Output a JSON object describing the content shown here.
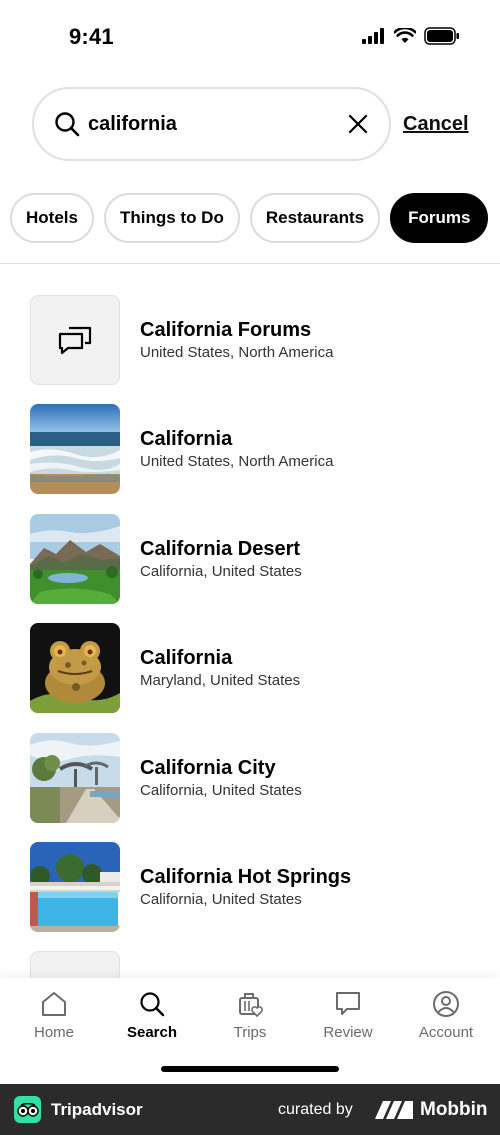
{
  "status_bar": {
    "time": "9:41"
  },
  "search": {
    "value": "california",
    "placeholder": "",
    "cancel_label": "Cancel"
  },
  "chips": [
    {
      "label": "Hotels",
      "active": false
    },
    {
      "label": "Things to Do",
      "active": false
    },
    {
      "label": "Restaurants",
      "active": false
    },
    {
      "label": "Forums",
      "active": true
    }
  ],
  "results": [
    {
      "title": "California Forums",
      "subtitle": "United States, North America",
      "thumb": "forum-icon"
    },
    {
      "title": "California",
      "subtitle": "United States, North America",
      "thumb": "beach-photo"
    },
    {
      "title": "California Desert",
      "subtitle": "California, United States",
      "thumb": "golf-course-photo"
    },
    {
      "title": "California",
      "subtitle": "Maryland, United States",
      "thumb": "frog-illustration"
    },
    {
      "title": "California City",
      "subtitle": "California, United States",
      "thumb": "park-photo"
    },
    {
      "title": "California Hot Springs",
      "subtitle": "California, United States",
      "thumb": "pool-photo"
    }
  ],
  "tab_bar": {
    "tabs": [
      {
        "label": "Home",
        "icon": "home-icon",
        "active": false
      },
      {
        "label": "Search",
        "icon": "search-icon",
        "active": true
      },
      {
        "label": "Trips",
        "icon": "suitcase-heart-icon",
        "active": false
      },
      {
        "label": "Review",
        "icon": "speech-bubble-icon",
        "active": false
      },
      {
        "label": "Account",
        "icon": "account-icon",
        "active": false
      }
    ]
  },
  "footer": {
    "brand": "Tripadvisor",
    "curated_by": "curated by",
    "partner": "Mobbin"
  },
  "colors": {
    "accent_green": "#34e0a1",
    "active_chip": "#000000",
    "footer_bg": "#2b2b2b"
  }
}
